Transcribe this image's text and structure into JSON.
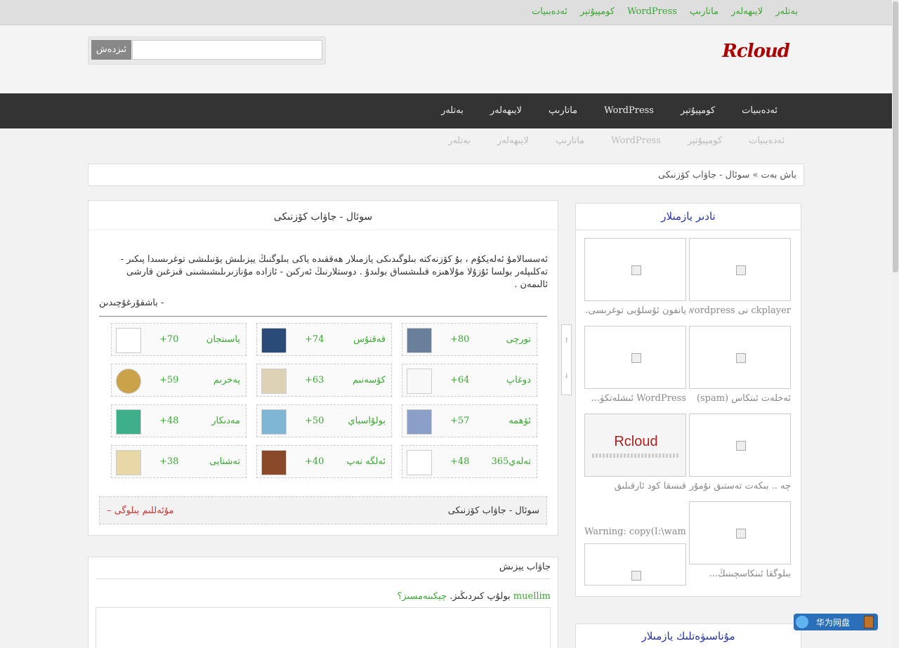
{
  "top_nav": [
    "ئەدەبىيات",
    "كومپيۇتېر",
    "WordPress",
    "ماتارىپ",
    "لايىھەلەر",
    "بەتلەر"
  ],
  "logo": "Rcloud",
  "search": {
    "button": "ئىزدەش",
    "placeholder": ""
  },
  "main_nav": [
    "ئەدەبىيات",
    "كومپيۇتېر",
    "WordPress",
    "ماتارىپ",
    "لايىھەلەر",
    "بەتلەر"
  ],
  "breadcrumb": {
    "home": "باش بەت",
    "sep": "»",
    "current": "سوئال - جاۋاب كۆزنىكى"
  },
  "article": {
    "title": "سوئال - جاۋاب كۆزنىكى",
    "body": "ئەسسالامۇ ئەلەيكۇم ، بۇ كۆزنەكتە بىلوگىدىكى يازمىلار ھەققىدە ياكى بىلوگنىڭ يېزىلىش يۆنىلىشى توغرىسىدا پىكىر - تەكلىپلەر بولسا ئۇزۇلا مۇلاھىزە قىلىشساق بولىدۇ . دوستلارنىڭ ئەركىن - ئازادە مۇنازىرىلىشىشىنى قىزغىن قارشى ئالىمەن .",
    "signature": "- باشقۇرغۇچىدىن",
    "donors": [
      {
        "name": "تورچى",
        "points": "+80"
      },
      {
        "name": "قەقنۇس",
        "points": "+74"
      },
      {
        "name": "ياسىنجان",
        "points": "+70"
      },
      {
        "name": "دوغاپ",
        "points": "+64"
      },
      {
        "name": "كۆسەنىم",
        "points": "+63"
      },
      {
        "name": "پەخرىم",
        "points": "+59"
      },
      {
        "name": "ئۆھمە",
        "points": "+57"
      },
      {
        "name": "بولۇاسباي",
        "points": "+50"
      },
      {
        "name": "مەدىكار",
        "points": "+48"
      },
      {
        "name": "تەلەي365",
        "points": "+48"
      },
      {
        "name": "ئەلگە نەپ",
        "points": "+40"
      },
      {
        "name": "تەشنايى",
        "points": "+38"
      }
    ],
    "footer_right": "سوئال - جاۋاب كۆزنىكى",
    "footer_left": "مۇئەللىم بىلوگى –"
  },
  "comment": {
    "title": "جاۋاب يېزىش",
    "user": "muellim",
    "logged": "بولۇپ كىردىڭىز.",
    "logout": "چېكىنەمسىز؟"
  },
  "sidebar": {
    "title": "نادىر يازمىلار",
    "captions": [
      "ckplayer نى wordpress",
      "يانفون ئۇسلۇبى توغرىسى...",
      "ئەخلەت ئىنكاس (spam)",
      "WordPress ئىشلەتكۈ...",
      "چە .. بىكەت تەستىق نۇمۇرد ...",
      "قىسقا كود ئارقىلىق",
      "بىلوگقا ئىنكاسچىنىڭ...",
      "Warning: copy(I:\\wamp\\v"
    ],
    "thumb_label": "Rcloud",
    "second_title": "مۇناسىۋەتلىك يازمىلار"
  },
  "widget": {
    "label": "华为网盘"
  },
  "scroll": {
    "up": "↑",
    "down": "↓"
  }
}
